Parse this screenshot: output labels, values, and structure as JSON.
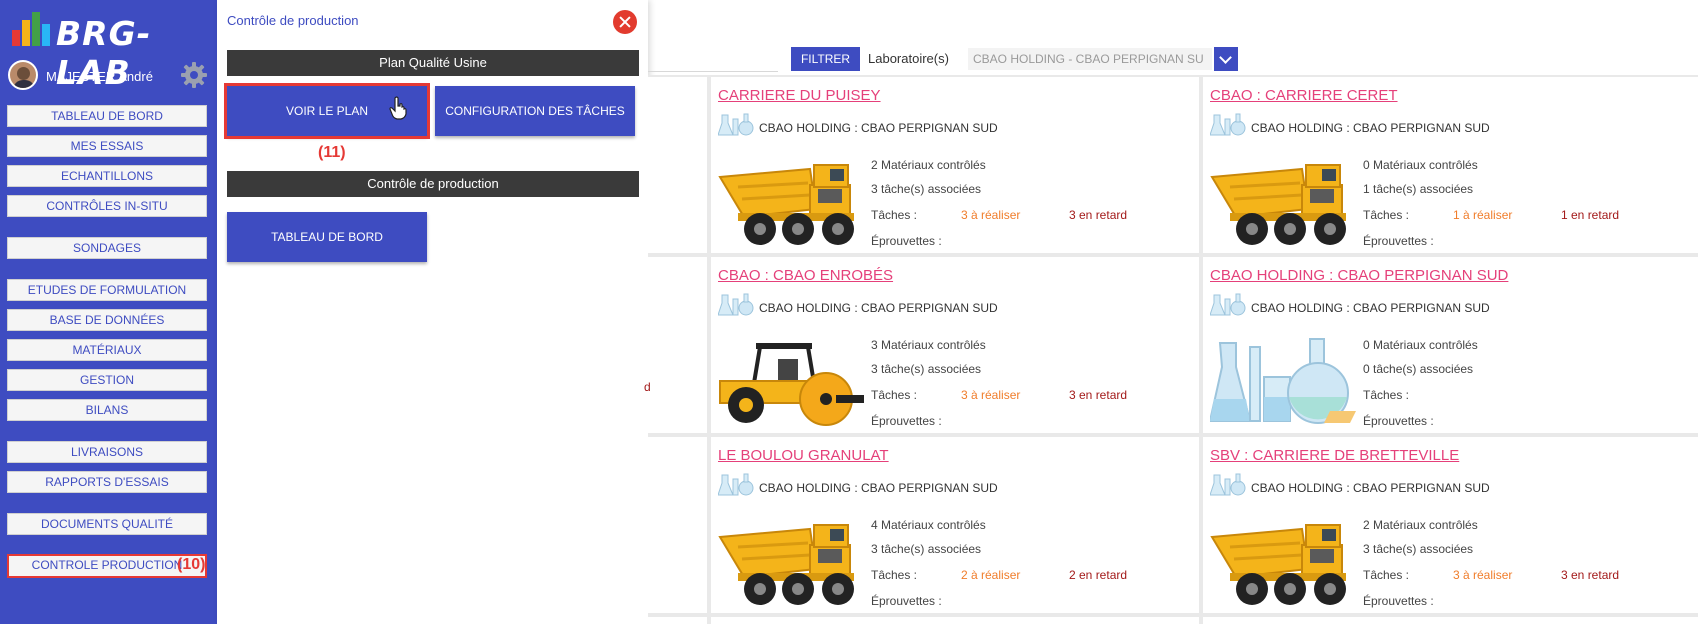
{
  "app": {
    "logo_text": "BRG-LAB",
    "user_name": "MAJESTER André"
  },
  "sidebar": {
    "items": [
      {
        "label": "TABLEAU DE BORD"
      },
      {
        "label": "MES ESSAIS"
      },
      {
        "label": "ECHANTILLONS"
      },
      {
        "label": "CONTRÔLES IN-SITU"
      },
      {
        "label": "SONDAGES"
      },
      {
        "label": "ETUDES DE FORMULATION"
      },
      {
        "label": "BASE DE DONNÉES"
      },
      {
        "label": "MATÉRIAUX"
      },
      {
        "label": "GESTION"
      },
      {
        "label": "BILANS"
      },
      {
        "label": "LIVRAISONS"
      },
      {
        "label": "RAPPORTS D'ESSAIS"
      },
      {
        "label": "DOCUMENTS QUALITÉ"
      },
      {
        "label": "CONTROLE PRODUCTION"
      }
    ],
    "annotation": "(10)"
  },
  "panel": {
    "title": "Contrôle de production",
    "section1": "Plan Qualité Usine",
    "voir_plan": "VOIR LE PLAN",
    "config_taches": "CONFIGURATION DES TÂCHES",
    "annotation": "(11)",
    "section2": "Contrôle de production",
    "tableau_bord": "TABLEAU DE BORD"
  },
  "filter": {
    "button": "FILTRER",
    "lab_label": "Laboratoire(s)",
    "lab_value": "CBAO HOLDING - CBAO PERPIGNAN SU"
  },
  "partial_text": "d",
  "cards": [
    {
      "title": "CARRIERE DU PUISEY",
      "sub": "CBAO HOLDING : CBAO PERPIGNAN SUD",
      "materials": "2 Matériaux contrôlés",
      "tasks": "3 tâche(s) associées",
      "taches_label": "Tâches :",
      "todo": "3 à réaliser",
      "late": "3 en retard",
      "eprouvettes": "Éprouvettes :",
      "illustration": "dump-truck"
    },
    {
      "title": "CBAO : CARRIERE CERET",
      "sub": "CBAO HOLDING : CBAO PERPIGNAN SUD",
      "materials": "0 Matériaux contrôlés",
      "tasks": "1 tâche(s) associées",
      "taches_label": "Tâches :",
      "todo": "1 à réaliser",
      "late": "1 en retard",
      "eprouvettes": "Éprouvettes :",
      "illustration": "dump-truck"
    },
    {
      "title": "CBAO : CBAO ENROBÉS",
      "sub": "CBAO HOLDING : CBAO PERPIGNAN SUD",
      "materials": "3 Matériaux contrôlés",
      "tasks": "3 tâche(s) associées",
      "taches_label": "Tâches :",
      "todo": "3 à réaliser",
      "late": "3 en retard",
      "eprouvettes": "Éprouvettes :",
      "illustration": "road-roller"
    },
    {
      "title": "CBAO HOLDING : CBAO PERPIGNAN SUD",
      "sub": "CBAO HOLDING : CBAO PERPIGNAN SUD",
      "materials": "0 Matériaux contrôlés",
      "tasks": "0 tâche(s) associées",
      "taches_label": "Tâches :",
      "todo": "",
      "late": "",
      "eprouvettes": "Éprouvettes :",
      "illustration": "lab-glassware"
    },
    {
      "title": "LE BOULOU GRANULAT",
      "sub": "CBAO HOLDING : CBAO PERPIGNAN SUD",
      "materials": "4 Matériaux contrôlés",
      "tasks": "3 tâche(s) associées",
      "taches_label": "Tâches :",
      "todo": "2 à réaliser",
      "late": "2 en retard",
      "eprouvettes": "Éprouvettes :",
      "illustration": "dump-truck"
    },
    {
      "title": "SBV : CARRIERE DE BRETTEVILLE",
      "sub": "CBAO HOLDING : CBAO PERPIGNAN SUD",
      "materials": "2 Matériaux contrôlés",
      "tasks": "3 tâche(s) associées",
      "taches_label": "Tâches :",
      "todo": "3 à réaliser",
      "late": "3 en retard",
      "eprouvettes": "Éprouvettes :",
      "illustration": "dump-truck"
    }
  ]
}
